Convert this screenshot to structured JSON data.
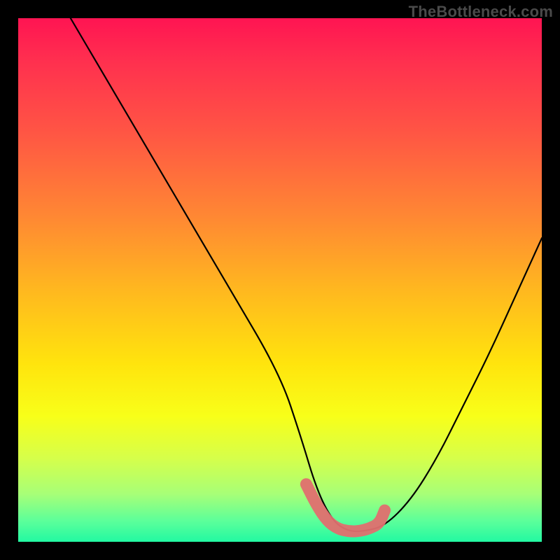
{
  "watermark": {
    "text": "TheBottleneck.com"
  },
  "chart_data": {
    "type": "line",
    "title": "",
    "xlabel": "",
    "ylabel": "",
    "xlim": [
      0,
      100
    ],
    "ylim": [
      0,
      100
    ],
    "series": [
      {
        "name": "curve",
        "x": [
          10,
          20,
          30,
          40,
          50,
          54,
          57,
          60,
          63,
          66,
          70,
          75,
          80,
          85,
          90,
          95,
          100
        ],
        "y": [
          100,
          83,
          66,
          49,
          32,
          20,
          10,
          4,
          2,
          2,
          3,
          8,
          16,
          26,
          36,
          47,
          58
        ]
      }
    ],
    "highlight": {
      "name": "plateau-marker",
      "color": "#e06f6f",
      "x": [
        55,
        57,
        59,
        61,
        63,
        65,
        67,
        69,
        70
      ],
      "y": [
        11,
        7,
        4,
        2.5,
        2,
        2,
        2.5,
        3.5,
        6
      ]
    }
  }
}
